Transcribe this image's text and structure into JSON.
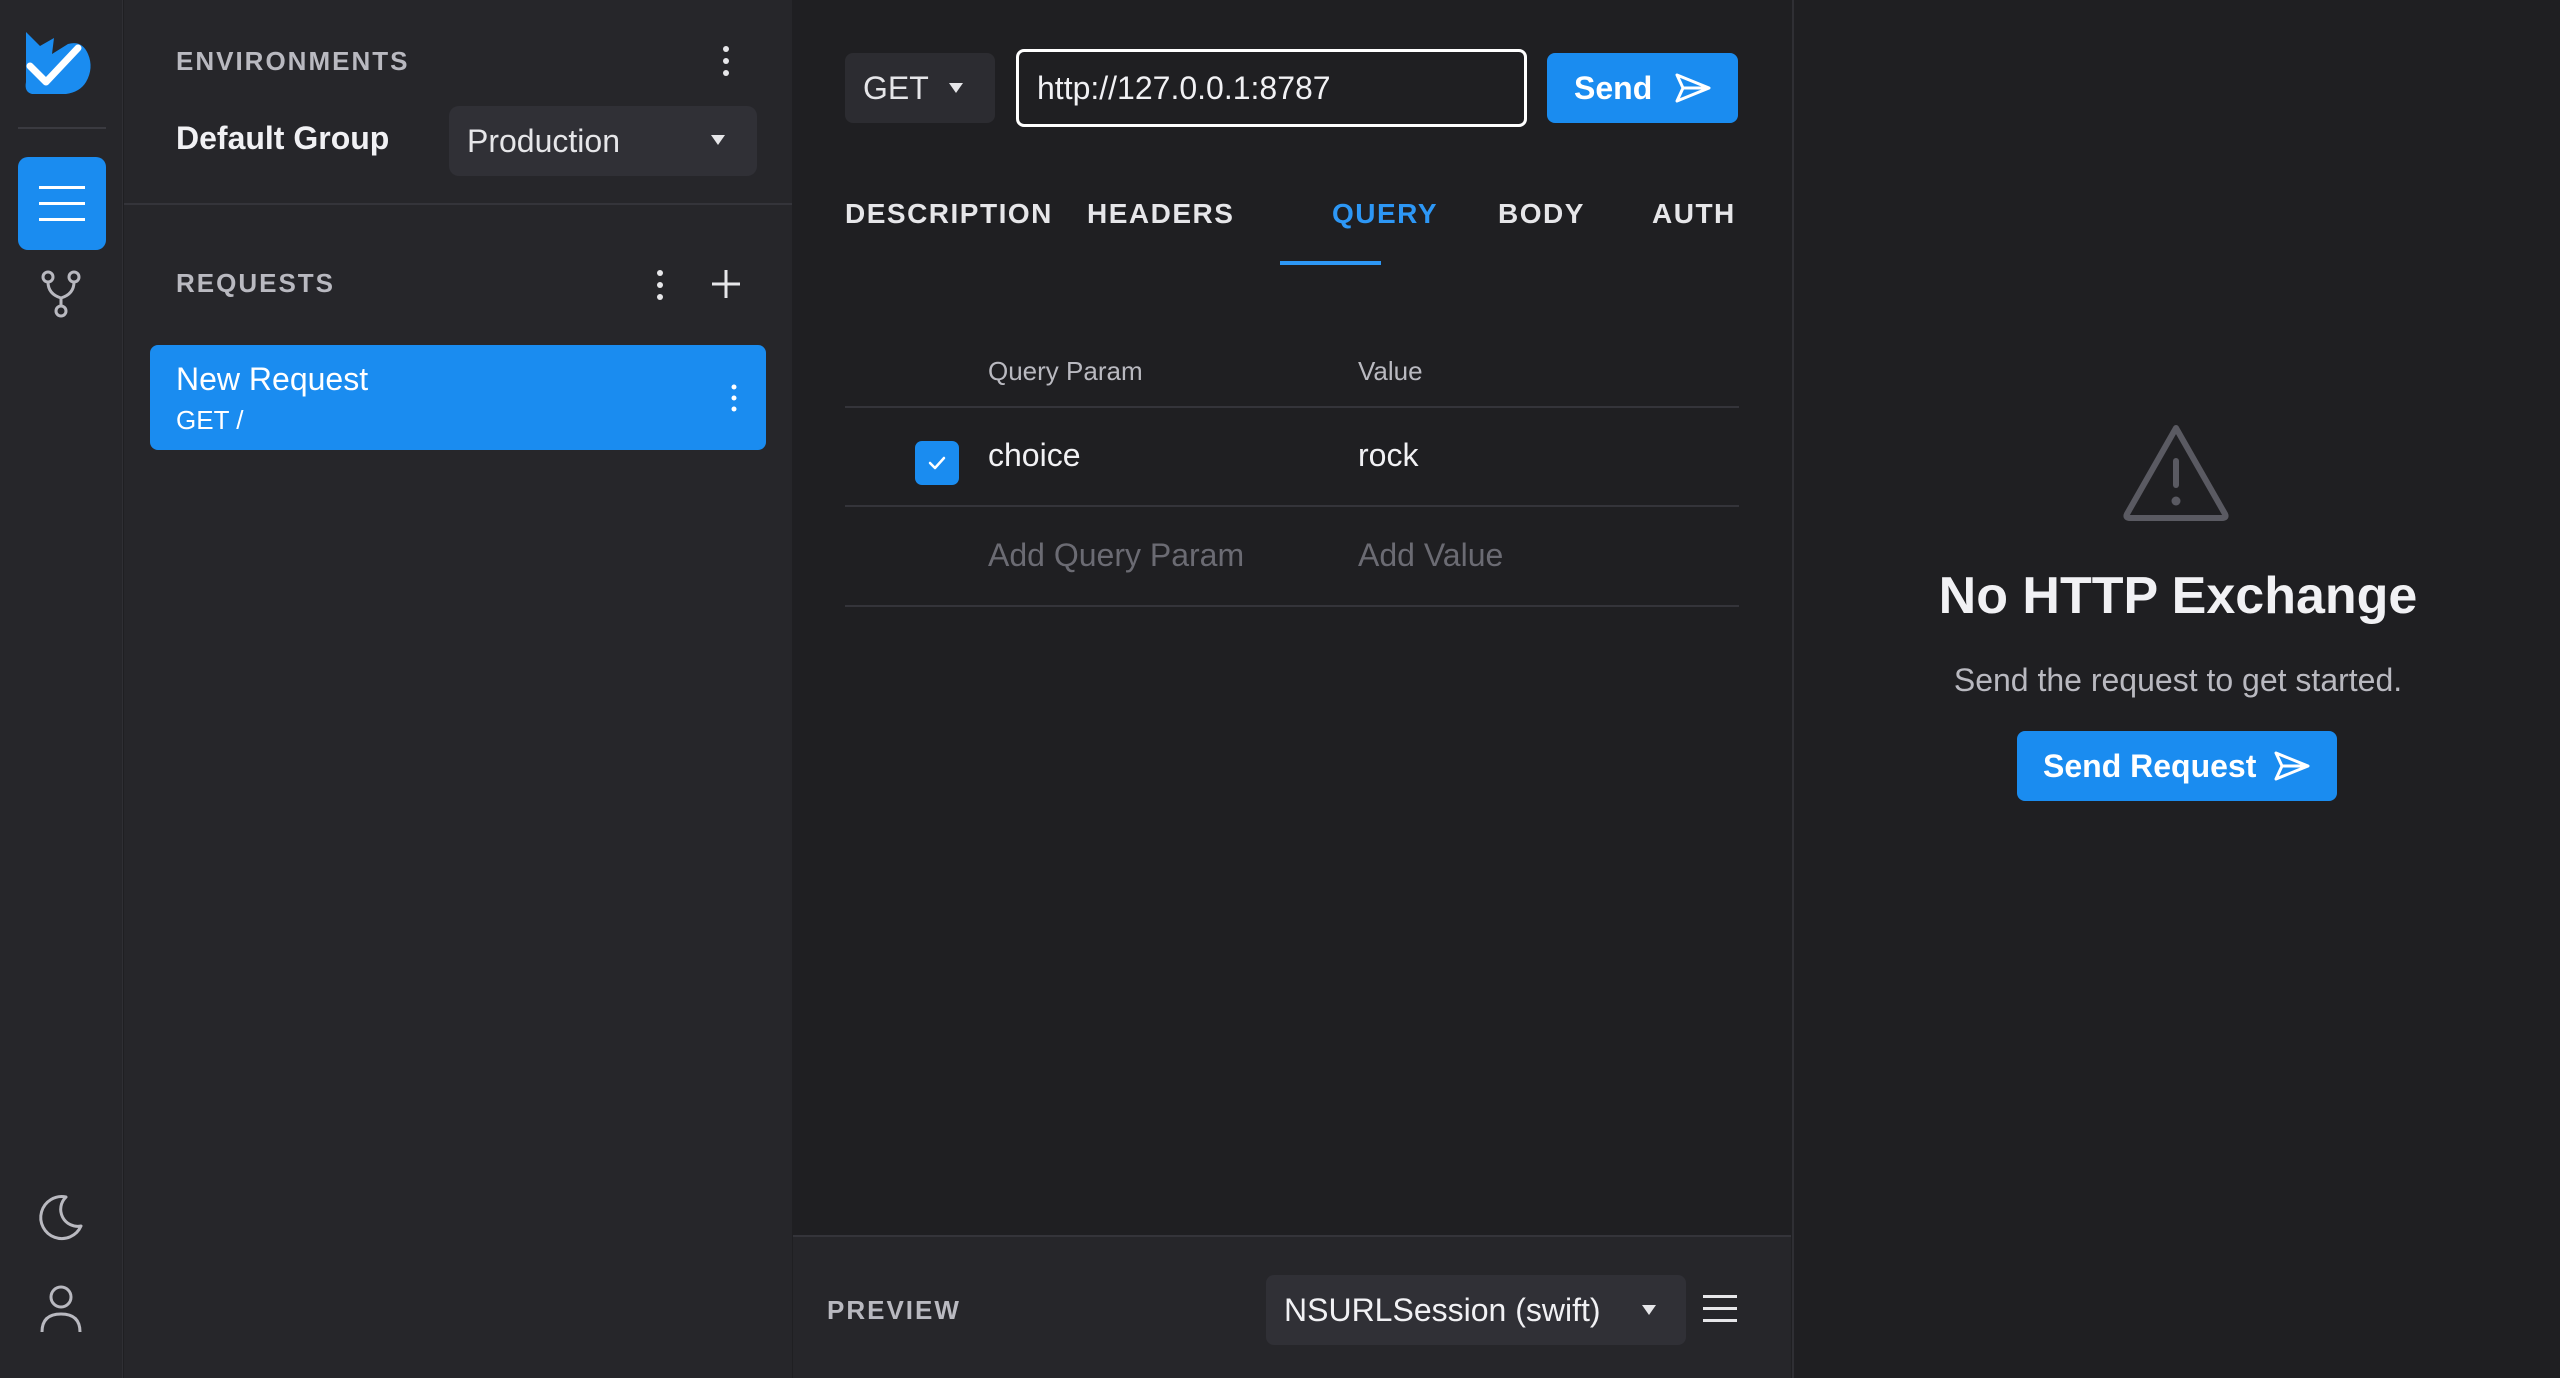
{
  "rail": {
    "logo": "fox-logo-icon",
    "items": [
      "menu-icon",
      "branch-icon"
    ],
    "bottom": [
      "moon-icon",
      "user-icon"
    ]
  },
  "environments": {
    "title": "ENVIRONMENTS",
    "group_label": "Default Group",
    "selected": "Production"
  },
  "requests": {
    "title": "REQUESTS",
    "items": [
      {
        "name": "New Request",
        "sub": "GET /"
      }
    ]
  },
  "request": {
    "method": "GET",
    "url": "http://127.0.0.1:8787",
    "send_label": "Send"
  },
  "tabs": [
    {
      "label": "DESCRIPTION",
      "active": false
    },
    {
      "label": "HEADERS",
      "active": false
    },
    {
      "label": "QUERY",
      "active": true
    },
    {
      "label": "BODY",
      "active": false
    },
    {
      "label": "AUTH",
      "active": false
    }
  ],
  "query": {
    "col_key": "Query Param",
    "col_value": "Value",
    "rows": [
      {
        "enabled": true,
        "key": "choice",
        "value": "rock"
      }
    ],
    "new_key_placeholder": "Add Query Param",
    "new_value_placeholder": "Add Value"
  },
  "preview": {
    "label": "PREVIEW",
    "language": "NSURLSession (swift)"
  },
  "response": {
    "title": "No HTTP Exchange",
    "subtitle": "Send the request to get started.",
    "button": "Send Request"
  },
  "colors": {
    "accent": "#1a8cf0",
    "tab_active": "#2d97f5",
    "bg": "#1f1f22",
    "panel": "#26262a"
  }
}
